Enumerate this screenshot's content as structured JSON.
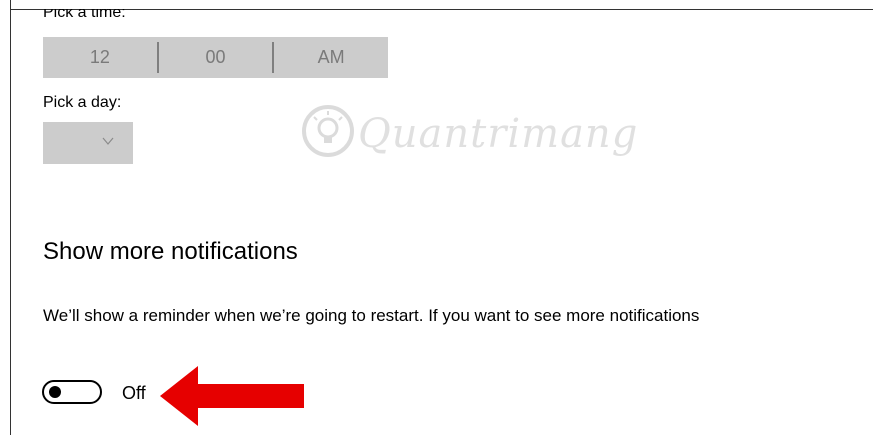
{
  "time_section": {
    "label": "Pick a time:",
    "hour": "12",
    "minute": "00",
    "period": "AM"
  },
  "day_section": {
    "label": "Pick a day:",
    "selected": ""
  },
  "notifications": {
    "heading": "Show more notifications",
    "description": "We’ll show a reminder when we’re going to restart. If you want to see more notifications",
    "toggle_state": "Off",
    "toggle_on": false
  },
  "watermark": {
    "text": "Quantrimang"
  },
  "colors": {
    "picker_bg": "#cccccc",
    "picker_text": "#7a7a7a",
    "arrow": "#e60000",
    "text": "#000000"
  },
  "icons": {
    "dropdown": "chevron-down-icon",
    "annotation": "arrow-left-icon",
    "watermark_logo": "lightbulb-icon"
  }
}
